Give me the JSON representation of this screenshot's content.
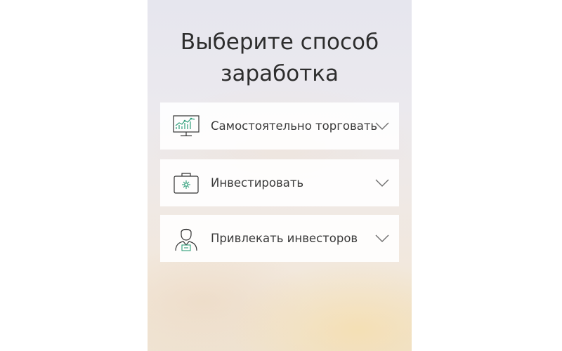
{
  "heading": {
    "line1": "Выберите способ",
    "line2": "заработка"
  },
  "options": [
    {
      "label": "Самостоятельно торговать",
      "icon": "trading-monitor-icon"
    },
    {
      "label": "Инвестировать",
      "icon": "briefcase-icon"
    },
    {
      "label": "Привлекать инвесторов",
      "icon": "person-advisor-icon"
    }
  ],
  "colors": {
    "accent": "#2e9e7a",
    "icon_stroke": "#333333",
    "text": "#3a3a3a",
    "heading": "#2d2d2d",
    "chevron": "#6e6e6e"
  }
}
